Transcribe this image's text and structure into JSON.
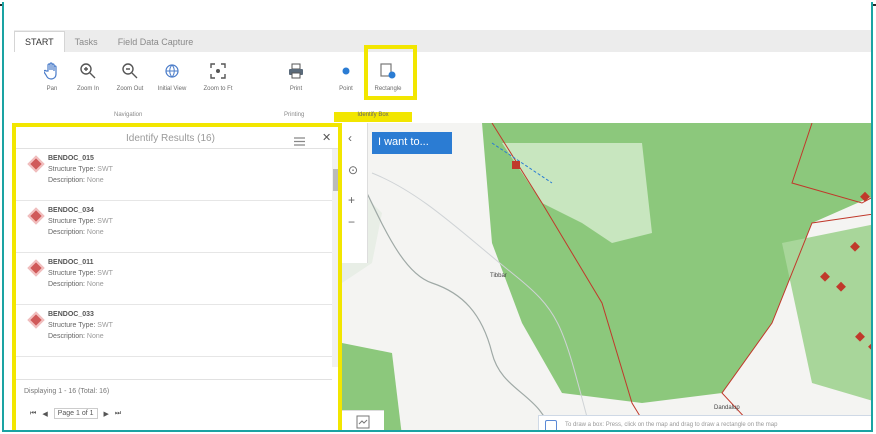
{
  "ribbon": {
    "tabs": [
      "START",
      "Tasks",
      "Field Data Capture"
    ],
    "tools": [
      {
        "label": "Pan",
        "icon": "hand-icon"
      },
      {
        "label": "Zoom In",
        "icon": "zoom-in-icon"
      },
      {
        "label": "Zoom Out",
        "icon": "zoom-out-icon"
      },
      {
        "label": "Initial View",
        "icon": "globe-icon"
      },
      {
        "label": "Zoom to Ft",
        "icon": "fit-extent-icon"
      },
      {
        "label": "Print",
        "icon": "printer-icon"
      },
      {
        "label": "Point",
        "icon": "point-icon"
      },
      {
        "label": "Rectangle",
        "icon": "rectangle-icon"
      }
    ],
    "groups": [
      "Navigation",
      "Printing",
      "Identify Box"
    ]
  },
  "identify": {
    "title": "Identify Results (16)",
    "results": [
      {
        "name": "BENDOC_015",
        "structure_label": "Structure Type:",
        "structure_value": "SWT",
        "desc_label": "Description:",
        "desc_value": "None"
      },
      {
        "name": "BENDOC_034",
        "structure_label": "Structure Type:",
        "structure_value": "SWT",
        "desc_label": "Description:",
        "desc_value": "None"
      },
      {
        "name": "BENDOC_011",
        "structure_label": "Structure Type:",
        "structure_value": "SWT",
        "desc_label": "Description:",
        "desc_value": "None"
      },
      {
        "name": "BENDOC_033",
        "structure_label": "Structure Type:",
        "structure_value": "SWT",
        "desc_label": "Description:",
        "desc_value": "None"
      }
    ],
    "displaying": "Displaying 1 - 16 (Total: 16)",
    "page": "Page 1 of 1"
  },
  "map": {
    "iwant": "I want to...",
    "labels": [
      "Tibbar",
      "Dandalup"
    ],
    "note": "To draw a box: Press, click on the map and drag to draw a rectangle on the map"
  },
  "colors": {
    "highlight": "#f2e600",
    "accent": "#2b7cd3",
    "forest": "#8cc87c",
    "boundary": "#c0392b"
  }
}
